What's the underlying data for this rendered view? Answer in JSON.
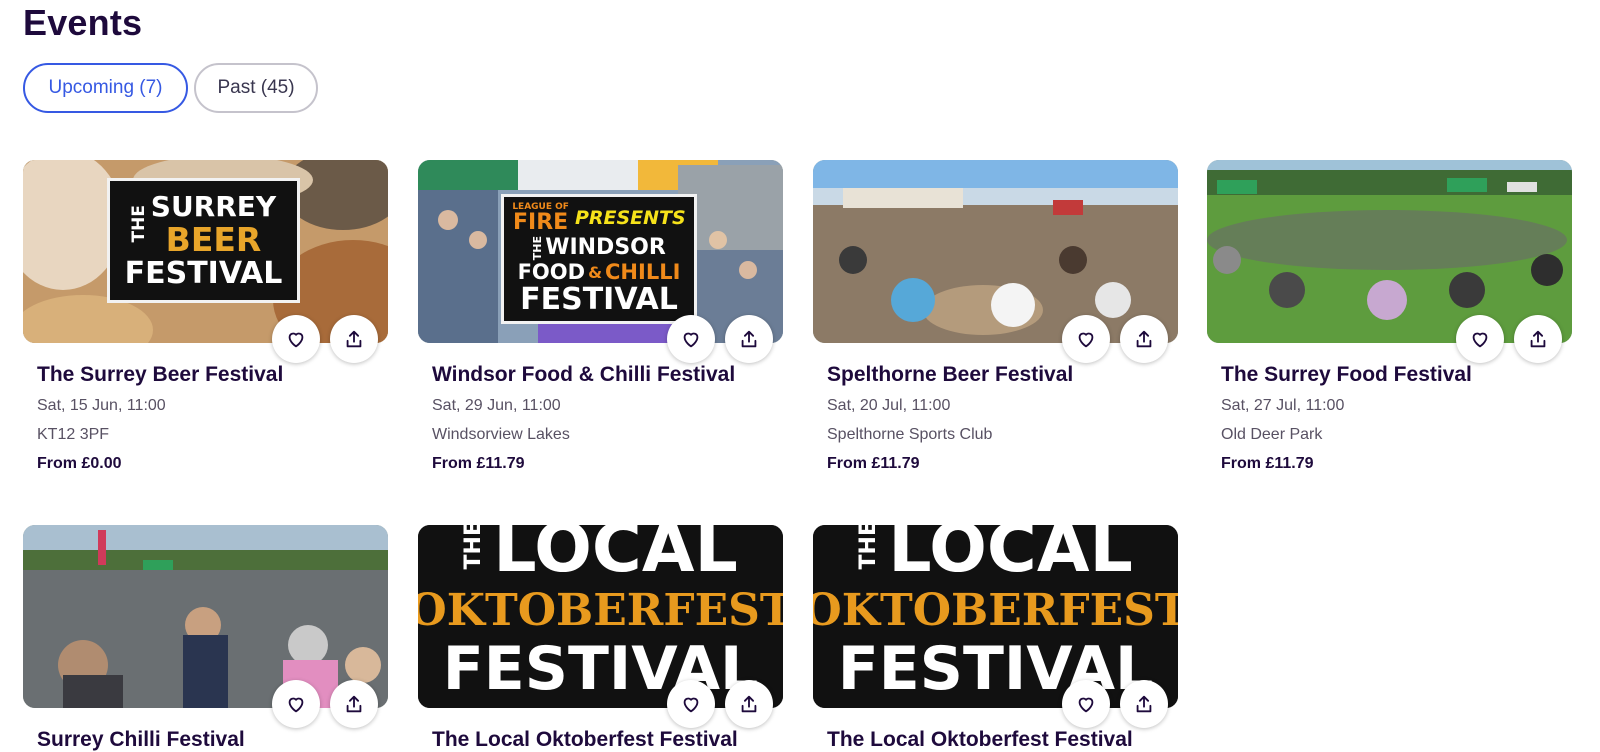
{
  "page_title": "Events",
  "tabs": [
    {
      "label": "Upcoming (7)",
      "active": true
    },
    {
      "label": "Past (45)",
      "active": false
    }
  ],
  "events": [
    {
      "title": "The Surrey Beer Festival",
      "date": "Sat, 15 Jun, 11:00",
      "venue": "KT12 3PF",
      "price": "From £0.00"
    },
    {
      "title": "Windsor Food & Chilli Festival",
      "date": "Sat, 29 Jun, 11:00",
      "venue": "Windsorview Lakes",
      "price": "From £11.79"
    },
    {
      "title": "Spelthorne Beer Festival",
      "date": "Sat, 20 Jul, 11:00",
      "venue": "Spelthorne Sports Club",
      "price": "From £11.79"
    },
    {
      "title": "The Surrey Food Festival",
      "date": "Sat, 27 Jul, 11:00",
      "venue": "Old Deer Park",
      "price": "From £11.79"
    },
    {
      "title": "Surrey Chilli Festival"
    },
    {
      "title": "The Local Oktoberfest Festival"
    },
    {
      "title": "The Local Oktoberfest Festival"
    }
  ],
  "posters": {
    "surrey_beer": {
      "the": "THE",
      "line1": "SURREY",
      "line2": "BEER",
      "line3": "FESTIVAL"
    },
    "windsor": {
      "league": "LEAGUE OF",
      "fire": "FIRE",
      "presents": "PRESENTS",
      "the": "THE",
      "windsor": "WINDSOR",
      "food": "FOOD",
      "amp": "&",
      "chilli": "CHILLI",
      "festival": "FESTIVAL"
    },
    "oktoberfest": {
      "the": "THE",
      "local": "LOCAL",
      "oktoberfest": "OKTOBERFEST",
      "festival": "FESTIVAL"
    }
  },
  "icons": {
    "favorite": "heart-icon",
    "share": "share-upload-icon"
  },
  "colors": {
    "accent": "#3659e3",
    "text": "#1e0a3c",
    "muted": "#585163"
  }
}
